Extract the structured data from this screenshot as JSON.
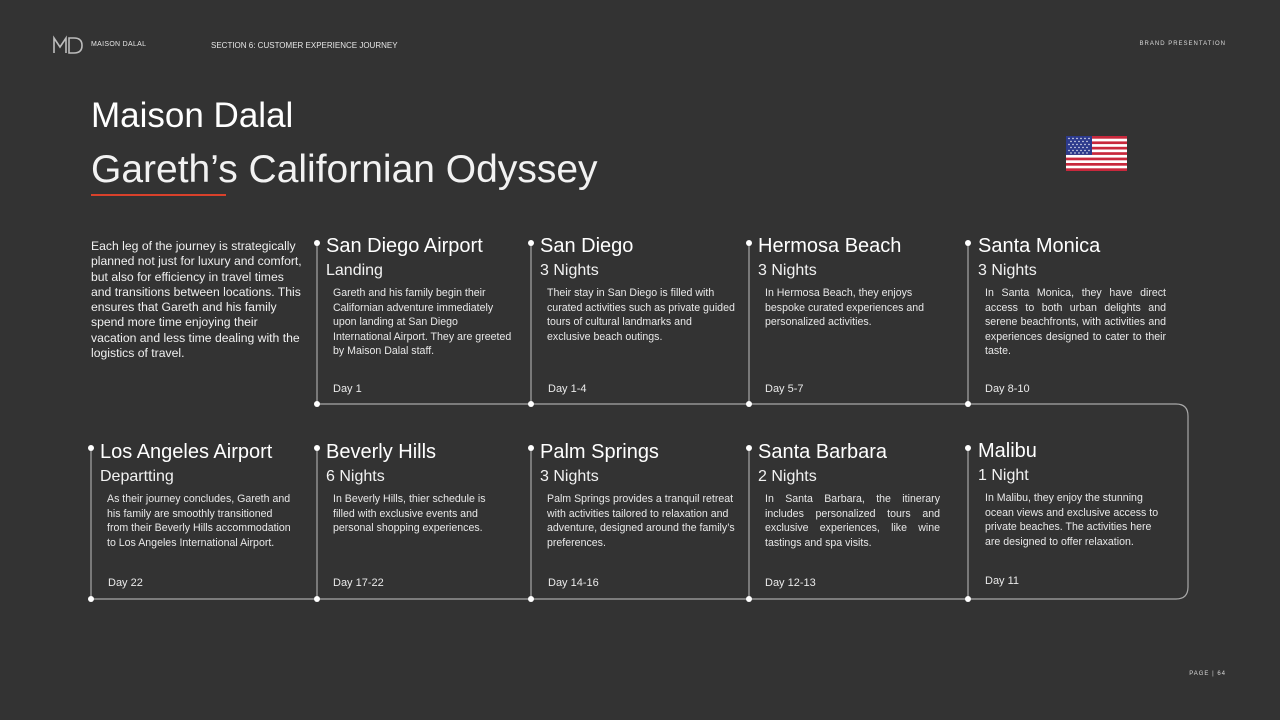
{
  "header": {
    "logo_text": "MD",
    "brand": "MAISON DALAL",
    "section": "SECTION 6: CUSTOMER EXPERIENCE JOURNEY",
    "label": "BRAND PRESENTATION"
  },
  "title": "Maison Dalal",
  "subtitle": "Gareth’s Californian Odyssey",
  "flag": "us-flag",
  "accent_color": "#d9412b",
  "intro": "Each leg of the journey is strategically planned not just for luxury and comfort, but also for efficiency in travel times and transitions between locations. This ensures that Gareth and his family spend more time enjoying their vacation and less time dealing with the logistics of travel.",
  "stops": [
    {
      "name": "San Diego Airport",
      "stay": "Landing",
      "description": "Gareth and his family begin their Californian adventure immediately upon landing at San Diego International Airport. They are greeted by Maison Dalal staff.",
      "day": "Day 1"
    },
    {
      "name": "San Diego",
      "stay": "3 Nights",
      "description": "Their stay in San Diego is filled with curated activities such as private guided tours of cultural landmarks and exclusive beach outings.",
      "day": "Day 1-4"
    },
    {
      "name": "Hermosa Beach",
      "stay": "3 Nights",
      "description": "In Hermosa Beach, they enjoys bespoke curated experiences and personalized activities.",
      "day": "Day 5-7"
    },
    {
      "name": "Santa Monica",
      "stay": "3 Nights",
      "description": "In Santa Monica, they have direct access to both urban delights and serene beachfronts, with activities and experiences designed to cater to their taste.",
      "day": "Day 8-10"
    },
    {
      "name": "Malibu",
      "stay": "1 Night",
      "description": "In Malibu, they enjoy the stunning ocean views and exclusive access to private beaches. The activities here are designed to offer relaxation.",
      "day": "Day 11"
    },
    {
      "name": "Santa Barbara",
      "stay": "2 Nights",
      "description": "In Santa Barbara, the itinerary includes personalized tours and exclusive experiences, like wine tastings and spa visits.",
      "day": "Day 12-13"
    },
    {
      "name": "Palm Springs",
      "stay": "3 Nights",
      "description": "Palm Springs provides a tranquil retreat with activities tailored to relaxation and adventure, designed around the family’s preferences.",
      "day": "Day 14-16"
    },
    {
      "name": "Beverly Hills",
      "stay": "6 Nights",
      "description": "In Beverly Hills, thier schedule is filled with exclusive events and personal shopping experiences.",
      "day": "Day 17-22"
    },
    {
      "name": "Los Angeles Airport",
      "stay": "Departting",
      "description": "As their journey concludes, Gareth and his family are smoothly transitioned from their Beverly Hills accommodation to Los Angeles International Airport.",
      "day": "Day 22"
    }
  ],
  "page": "PAGE | 64"
}
